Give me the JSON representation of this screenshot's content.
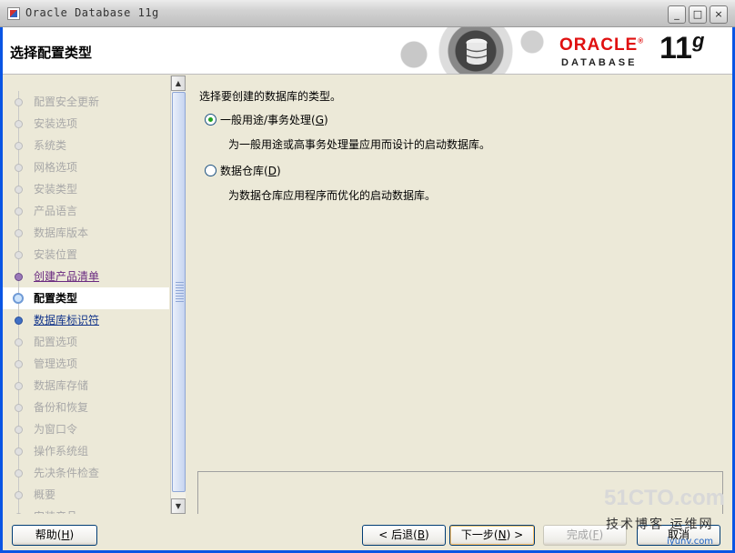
{
  "window": {
    "title": "Oracle Database 11g",
    "minimize_label": "_",
    "maximize_label": "□",
    "close_label": "×"
  },
  "header": {
    "page_title": "选择配置类型",
    "logo_text": "ORACLE",
    "logo_registered": "®",
    "logo_sub": "DATABASE",
    "version": "11",
    "version_suffix": "g"
  },
  "nav": {
    "items": [
      {
        "label": "配置安全更新",
        "state": "done-faded"
      },
      {
        "label": "安装选项",
        "state": "done-faded"
      },
      {
        "label": "系统类",
        "state": "done-faded"
      },
      {
        "label": "网格选项",
        "state": "done-faded"
      },
      {
        "label": "安装类型",
        "state": "done-faded"
      },
      {
        "label": "产品语言",
        "state": "done-faded"
      },
      {
        "label": "数据库版本",
        "state": "done-faded"
      },
      {
        "label": "安装位置",
        "state": "done-faded"
      },
      {
        "label": "创建产品清单",
        "state": "done"
      },
      {
        "label": "配置类型",
        "state": "current"
      },
      {
        "label": "数据库标识符",
        "state": "next"
      },
      {
        "label": "配置选项",
        "state": "pending"
      },
      {
        "label": "管理选项",
        "state": "pending"
      },
      {
        "label": "数据库存储",
        "state": "pending"
      },
      {
        "label": "备份和恢复",
        "state": "pending"
      },
      {
        "label": "为窗口令",
        "state": "pending"
      },
      {
        "label": "操作系统组",
        "state": "pending"
      },
      {
        "label": "先决条件检查",
        "state": "pending"
      },
      {
        "label": "概要",
        "state": "pending"
      },
      {
        "label": "安装产品",
        "state": "pending"
      }
    ],
    "scroll_up": "▲",
    "scroll_down": "▼"
  },
  "main": {
    "prompt": "选择要创建的数据库的类型。",
    "options": [
      {
        "label": "一般用途/事务处理",
        "accel": "G",
        "checked": true,
        "description": "为一般用途或高事务处理量应用而设计的启动数据库。"
      },
      {
        "label": "数据仓库",
        "accel": "D",
        "checked": false,
        "description": "为数据仓库应用程序而优化的启动数据库。"
      }
    ]
  },
  "buttons": {
    "help": {
      "label": "帮助",
      "accel": "H"
    },
    "back": {
      "label": "< 后退",
      "accel": "B"
    },
    "next": {
      "label": "下一步",
      "accel": "N",
      "suffix": " >"
    },
    "finish": {
      "label": "完成",
      "accel": "F"
    },
    "cancel": {
      "label": "取消"
    }
  },
  "watermark": {
    "site": "51CTO.com",
    "slogan": "技术博客 运维网",
    "url": "iyunv.com"
  }
}
